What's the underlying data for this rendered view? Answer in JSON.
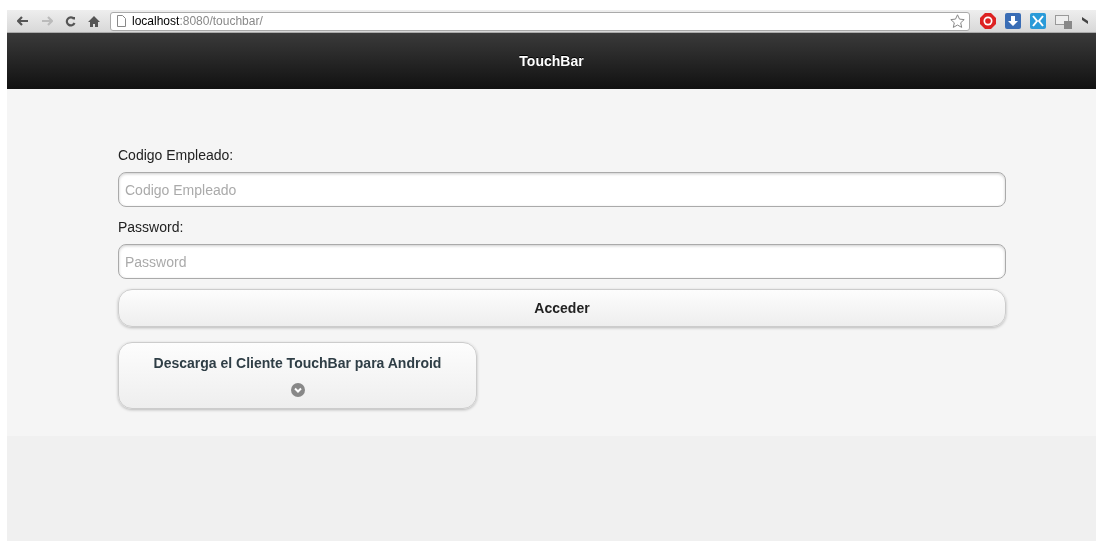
{
  "browser": {
    "url": "**localhost**:8080/touchbar/"
  },
  "header": {
    "title": "TouchBar"
  },
  "form": {
    "fields": [
      {
        "label": "Codigo Empleado:",
        "placeholder": "Codigo Empleado"
      },
      {
        "label": "Password:",
        "placeholder": "Password"
      }
    ],
    "submit": "Acceder"
  },
  "download": {
    "title": "Descarga el Cliente TouchBar para Android",
    "expanded": false
  }
}
